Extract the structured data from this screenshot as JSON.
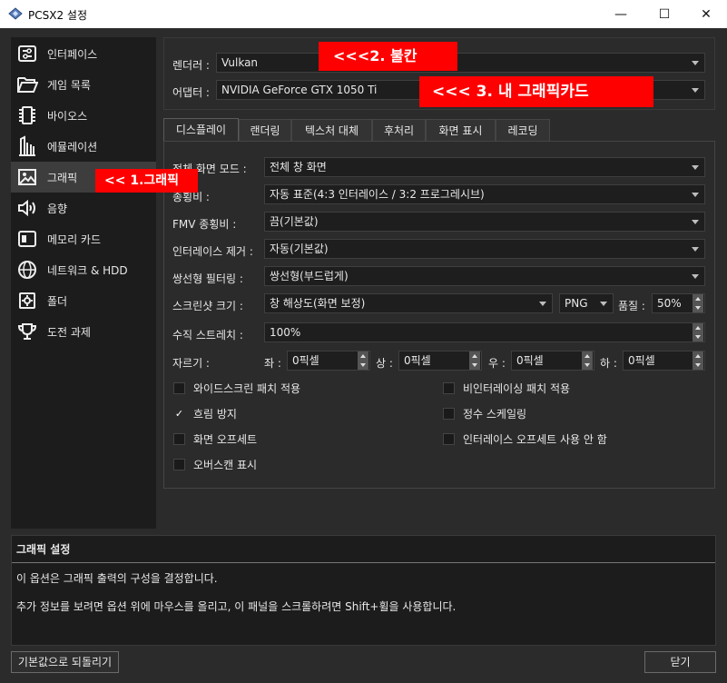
{
  "window": {
    "title": "PCSX2 설정",
    "minimize": "—",
    "maximize": "☐",
    "close": "✕"
  },
  "sidebar": {
    "items": [
      {
        "label": "인터페이스",
        "icon": "interface-sliders-icon"
      },
      {
        "label": "게임 목록",
        "icon": "folder-open-icon"
      },
      {
        "label": "바이오스",
        "icon": "chip-icon"
      },
      {
        "label": "에뮬레이션",
        "icon": "emulation-bars-icon"
      },
      {
        "label": "그래픽",
        "icon": "image-icon",
        "active": true
      },
      {
        "label": "음향",
        "icon": "speaker-icon"
      },
      {
        "label": "메모리 카드",
        "icon": "memory-card-icon"
      },
      {
        "label": "네트워크 & HDD",
        "icon": "globe-icon"
      },
      {
        "label": "폴더",
        "icon": "settings-folder-icon"
      },
      {
        "label": "도전 과제",
        "icon": "trophy-icon"
      }
    ]
  },
  "renderer": {
    "label": "렌더러 :",
    "value": "Vulkan"
  },
  "adapter": {
    "label": "어댑터 :",
    "value": "NVIDIA GeForce GTX 1050 Ti"
  },
  "tabs": [
    "디스플레이",
    "랜더링",
    "텍스처 대체",
    "후처리",
    "화면 표시",
    "레코딩"
  ],
  "display": {
    "fullscreen_mode": {
      "label": "전체 화면 모드 :",
      "value": "전체 창 화면"
    },
    "aspect_ratio": {
      "label": "종횡비 :",
      "value": "자동 표준(4:3 인터레이스 / 3:2 프로그레시브)"
    },
    "fmv_aspect": {
      "label": "FMV 종횡비 :",
      "value": "끔(기본값)"
    },
    "deinterlace": {
      "label": "인터레이스 제거 :",
      "value": "자동(기본값)"
    },
    "bilinear": {
      "label": "쌍선형 필터링 :",
      "value": "쌍선형(부드럽게)"
    },
    "screenshot": {
      "label": "스크린샷 크기 :",
      "value": "창 해상도(화면 보정)",
      "format": "PNG",
      "quality_label": "품질 :",
      "quality": "50%"
    },
    "vstretch": {
      "label": "수직 스트레치 :",
      "value": "100%"
    },
    "crop": {
      "label": "자르기 :",
      "left_label": "좌 :",
      "left": "0픽셀",
      "top_label": "상 :",
      "top": "0픽셀",
      "right_label": "우 :",
      "right": "0픽셀",
      "bottom_label": "하 :",
      "bottom": "0픽셀"
    },
    "checkboxes": [
      {
        "label": "와이드스크린 패치 적용",
        "checked": false
      },
      {
        "label": "비인터레이싱 패치 적용",
        "checked": false
      },
      {
        "label": "흐림 방지",
        "checked": true
      },
      {
        "label": "정수 스케일링",
        "checked": false
      },
      {
        "label": "화면 오프세트",
        "checked": false
      },
      {
        "label": "인터레이스 오프세트 사용 안 함",
        "checked": false
      },
      {
        "label": "오버스캔 표시",
        "checked": false
      }
    ]
  },
  "info": {
    "title": "그래픽 설정",
    "line1": "이 옵션은 그래픽 출력의 구성을 결정합니다.",
    "line2": "추가 정보를 보려면 옵션 위에 마우스를 올리고, 이 패널을 스크롤하려면 Shift+휠을 사용합니다."
  },
  "buttons": {
    "reset": "기본값으로 되돌리기",
    "close": "닫기"
  },
  "callouts": {
    "c1": "<< 1.그래픽",
    "c2": "<<<2. 불칸",
    "c3": "<<< 3. 내 그래픽카드"
  },
  "colors": {
    "callout": "#ff0000",
    "background": "#2b2b2b",
    "sidebar": "#1c1c1c"
  },
  "checkmark": "✓"
}
